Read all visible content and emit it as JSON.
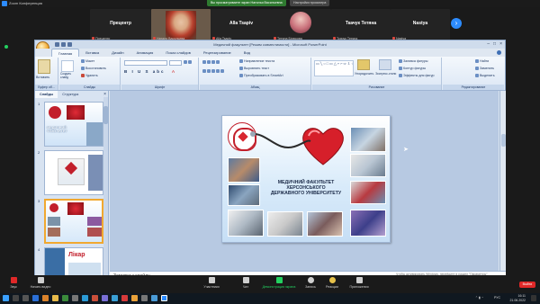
{
  "zoom": {
    "window_title": "Zoom Конференция",
    "speaker_banner": "Вы просматриваете экран Наталья Васильевна",
    "view_options": "Настройки просмотра",
    "view_label": "Вид",
    "participants": [
      {
        "name": "Прецентр",
        "sub": "Прецентр"
      },
      {
        "name": "",
        "sub": "Наталя Васильева"
      },
      {
        "name": "Alla Tsapiv",
        "sub": "Alla Tsapiv"
      },
      {
        "name": "",
        "sub": "Тетяна Бірюкова"
      },
      {
        "name": "Ткачук Тетяна",
        "sub": "Ткачук Тетяна"
      },
      {
        "name": "Nastya",
        "sub": "Nastya"
      }
    ],
    "controls": [
      {
        "label": "Звук",
        "icon": "microphone-icon"
      },
      {
        "label": "Начать видео",
        "icon": "video-camera-icon"
      },
      {
        "label": "Участники",
        "icon": "participants-icon"
      },
      {
        "label": "Чат",
        "icon": "chat-icon"
      },
      {
        "label": "Демонстрация экрана",
        "icon": "share-screen-icon"
      },
      {
        "label": "Запись",
        "icon": "record-icon"
      },
      {
        "label": "Реакции",
        "icon": "reactions-icon"
      },
      {
        "label": "Приложения",
        "icon": "apps-icon"
      }
    ],
    "leave_label": "Выйти",
    "watermark": "Чтобы активировать Windows, перейдите в раздел \"Параметры\"."
  },
  "ppt": {
    "title": "Медичний факультет [Режим совместимости] - Microsoft PowerPoint",
    "tabs": [
      "Главная",
      "Вставка",
      "Дизайн",
      "Анимация",
      "Показ слайдов",
      "Рецензирование",
      "Вид"
    ],
    "ribbon": {
      "paste": "Вставить",
      "layout": "Макет",
      "reset": "Восстановить",
      "new_slide": "Создать слайд",
      "delete": "Удалить",
      "text_direction": "Направление текста",
      "align_text": "Выровнять текст",
      "smartart": "Преобразовать в SmartArt",
      "arrange": "Упорядочить",
      "quick_styles": "Экспресс-стили",
      "shape_fill": "Заливка фигуры",
      "shape_outline": "Контур фигуры",
      "shape_effects": "Эффекты для фигур",
      "find": "Найти",
      "replace": "Заменить",
      "select": "Выделить",
      "groups": [
        "Буфер об...",
        "Слайды",
        "Шрифт",
        "Абзац",
        "Рисование",
        "Редактирование"
      ]
    },
    "panel_tabs": [
      "Слайды",
      "Структура"
    ],
    "thumb_numbers": [
      "1",
      "2",
      "3",
      "4"
    ],
    "thumb_text": {
      "t1": "МЕДИЧНИЙ ФАКУЛЬТЕТ",
      "t4": "Лікар"
    },
    "notes_placeholder": "Заметки к слайду"
  },
  "slide": {
    "title_lines": [
      "МЕДИЧНИЙ ФАКУЛЬТЕТ",
      "ХЕРСОНСЬКОГО",
      "ДЕРЖАВНОГО УНІВЕРСИТЕТУ"
    ]
  },
  "taskbar": {
    "time": "16:11",
    "date": "21.06.2022",
    "lang": "РУС"
  }
}
